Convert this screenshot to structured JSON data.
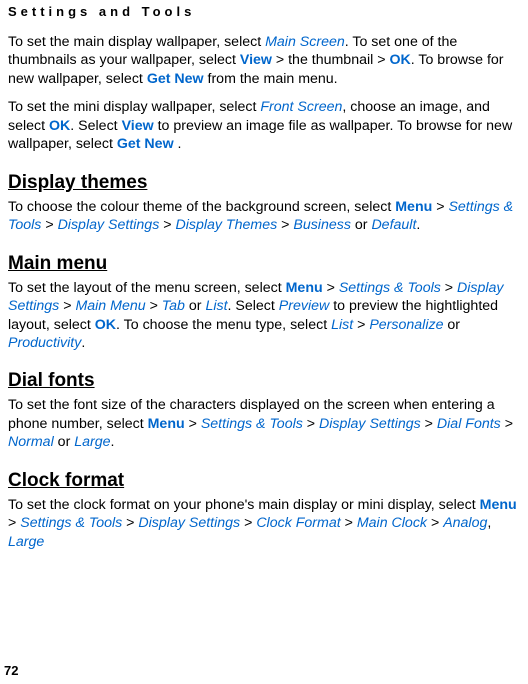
{
  "header": "Settings and Tools",
  "para1": {
    "t1": "To set the main display wallpaper, select ",
    "main_screen": "Main Screen",
    "t2": ". To set one of the thumbnails as your wallpaper, select ",
    "view": "View",
    "t3": " > the thumbnail > ",
    "ok": "OK",
    "t4": ". To browse for new wallpaper, select ",
    "get_new": "Get New",
    "t5": " from the main menu."
  },
  "para2": {
    "t1": "To set the mini display wallpaper, select ",
    "front_screen": "Front Screen",
    "t2": ", choose an image, and select ",
    "ok": "OK",
    "t3": ". Select ",
    "view": "View",
    "t4": " to preview an image file as wallpaper. To browse for new wallpaper, select ",
    "get_new": "Get New",
    "t5": " ."
  },
  "section1": {
    "title": "Display themes",
    "t1": "To choose the colour theme of the background screen, select ",
    "menu": "Menu",
    "gt1": " > ",
    "settings_tools": "Settings & Tools",
    "gt2": " > ",
    "display_settings": "Display Settings",
    "gt3": " > ",
    "display_themes": "Display Themes",
    "gt4": " > ",
    "business": "Business",
    "or": " or ",
    "default": "Default",
    "dot": "."
  },
  "section2": {
    "title": "Main menu",
    "t1": "To set the layout of the menu screen, select ",
    "menu": "Menu",
    "gt1": " > ",
    "settings_tools": "Settings & Tools",
    "gt2": " > ",
    "display_settings": "Display Settings",
    "gt3": " > ",
    "main_menu": "Main Menu",
    "gt4": " > ",
    "tab": "Tab",
    "or1": " or ",
    "list": "List",
    "t2": ". Select ",
    "preview": "Preview",
    "t3": " to preview the hightlighted layout, select ",
    "ok": "OK",
    "t4": ". To choose the menu type, select ",
    "list2": "List",
    "gt5": " > ",
    "personalize": "Personalize",
    "or2": " or ",
    "productivity": "Productivity",
    "dot": "."
  },
  "section3": {
    "title": "Dial fonts",
    "t1": "To set the font size of the characters displayed on the screen when entering a phone number, select ",
    "menu": "Menu",
    "gt1": " > ",
    "settings_tools": "Settings & Tools",
    "gt2": " > ",
    "display_settings": "Display Settings",
    "gt3": " > ",
    "dial_fonts": "Dial Fonts",
    "gt4": "  > ",
    "normal": "Normal",
    "or": " or ",
    "large": "Large",
    "dot": "."
  },
  "section4": {
    "title": "Clock format",
    "t1": "To set the clock format on your phone's main display or mini display, select ",
    "menu": "Menu",
    "gt1": " > ",
    "settings_tools": "Settings & Tools",
    "gt2": " > ",
    "display_settings": "Display Settings",
    "gt3": " > ",
    "clock_format": "Clock Format",
    "gt4": " > ",
    "main_clock": "Main Clock",
    "gt5": " > ",
    "analog": "Analog",
    "comma": ", ",
    "large": "Large"
  },
  "page_number": "72"
}
